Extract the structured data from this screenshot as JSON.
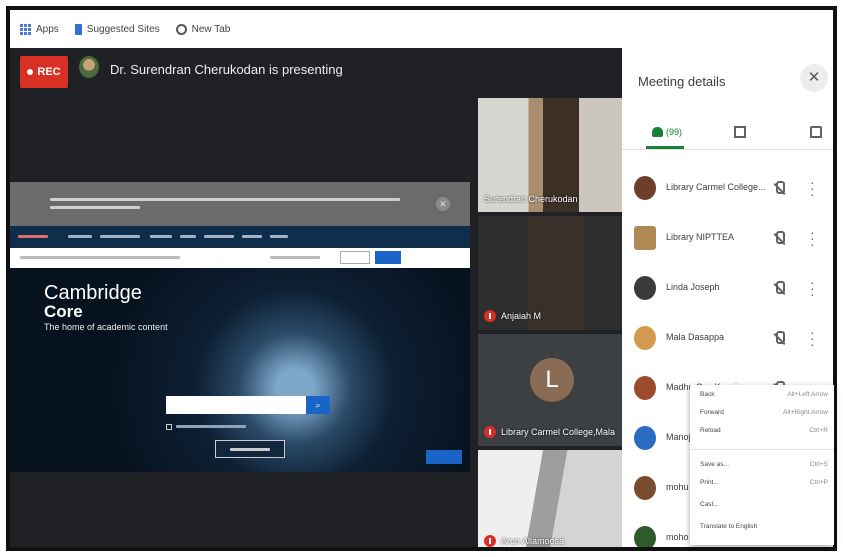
{
  "bookmarks": {
    "apps": "Apps",
    "suggested": "Suggested Sites",
    "new_tab": "New Tab"
  },
  "meet": {
    "rec_label": "REC",
    "presenting_text": "Dr. Surendran Cherukodan is presenting"
  },
  "shared_screen": {
    "brand_line1": "Cambridge",
    "brand_line2": "Core",
    "tagline": "The home of academic content"
  },
  "tiles": [
    {
      "name": "Surendran Cherukodan"
    },
    {
      "name": "Anjaiah M"
    },
    {
      "name": "Library Carmel College,Mala",
      "avatar_letter": "L"
    },
    {
      "name": "Arun Allamoosa"
    }
  ],
  "panel": {
    "title": "Meeting details",
    "people_count": "(99)",
    "participants": [
      {
        "name": "Library Carmel College..."
      },
      {
        "name": "Library NIPTTEA"
      },
      {
        "name": "Linda Joseph"
      },
      {
        "name": "Mala Dasappa"
      },
      {
        "name": "Madhu Cax Kuosio"
      },
      {
        "name": "Manoj"
      },
      {
        "name": "mohu"
      },
      {
        "name": "moho"
      }
    ]
  },
  "context_menu": {
    "items": [
      {
        "label": "Back",
        "shortcut": "Alt+Left Arrow"
      },
      {
        "label": "Forward",
        "shortcut": "Alt+Right Arrow"
      },
      {
        "label": "Reload",
        "shortcut": "Ctrl+R"
      },
      {
        "label": "Save as...",
        "shortcut": "Ctrl+S"
      },
      {
        "label": "Print...",
        "shortcut": "Ctrl+P"
      },
      {
        "label": "Cast...",
        "shortcut": ""
      },
      {
        "label": "Translate to English",
        "shortcut": ""
      }
    ]
  },
  "colors": {
    "rec_red": "#d93025",
    "meet_green": "#188038",
    "meet_bg": "#202124",
    "cambridge_blue": "#1a63c7"
  }
}
